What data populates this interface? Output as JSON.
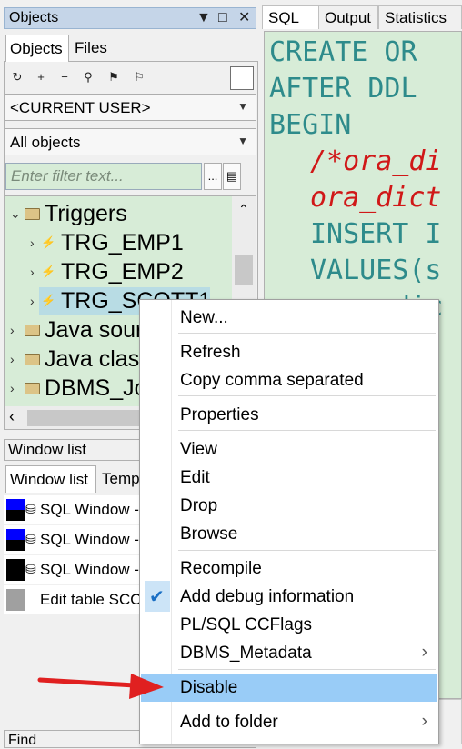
{
  "objects_panel": {
    "title": "Objects",
    "title_buttons": [
      "▼",
      "□",
      "✕"
    ],
    "tabs": [
      "Objects",
      "Files"
    ],
    "owner_combo": "<CURRENT USER>",
    "filter_combo": "All objects",
    "filter_placeholder": "Enter filter text...",
    "filter_btn_label": "...",
    "tree": [
      {
        "label": "Triggers",
        "kind": "folder",
        "expanded": true
      },
      {
        "label": "TRG_EMP1",
        "kind": "trigger"
      },
      {
        "label": "TRG_EMP2",
        "kind": "trigger"
      },
      {
        "label": "TRG_SCOTT1",
        "kind": "trigger",
        "selected": true
      },
      {
        "label": "Java sources",
        "kind": "folder"
      },
      {
        "label": "Java classes",
        "kind": "folder"
      },
      {
        "label": "DBMS_Jobs",
        "kind": "folder"
      }
    ]
  },
  "window_list": {
    "title": "Window list",
    "tabs": [
      "Window list",
      "Templates"
    ],
    "rows": [
      {
        "label": "SQL Window - ",
        "color": "#0000ff"
      },
      {
        "label": "SQL Window - ",
        "color": "#0000ff"
      },
      {
        "label": "SQL Window - ",
        "color": "#000000"
      },
      {
        "label": "Edit table SCOTT",
        "color": "#a0a0a0"
      }
    ]
  },
  "find_bar": {
    "label": "Find"
  },
  "editor": {
    "tabs": [
      "SQL",
      "Output",
      "Statistics"
    ],
    "lines": [
      {
        "text": "CREATE OR",
        "kind": "kw",
        "indent": 0
      },
      {
        "text": "AFTER DDL",
        "kind": "kw",
        "indent": 0
      },
      {
        "text": "BEGIN",
        "kind": "kw",
        "indent": 0
      },
      {
        "text": "/*ora_di",
        "kind": "cm",
        "indent": 2
      },
      {
        "text": "ora_dict",
        "kind": "cm",
        "indent": 2
      },
      {
        "text": "INSERT I",
        "kind": "kw",
        "indent": 2
      },
      {
        "text": "VALUES(s",
        "kind": "kw",
        "indent": 2
      },
      {
        "text": "dic",
        "kind": "kw",
        "indent": 8
      }
    ]
  },
  "context_menu": {
    "items": [
      {
        "label": "New...",
        "group": 1
      },
      {
        "label": "Refresh",
        "group": 2
      },
      {
        "label": "Copy comma separated",
        "group": 2
      },
      {
        "label": "Properties",
        "group": 3
      },
      {
        "label": "View",
        "group": 4
      },
      {
        "label": "Edit",
        "group": 4
      },
      {
        "label": "Drop",
        "group": 4
      },
      {
        "label": "Browse",
        "group": 4
      },
      {
        "label": "Recompile",
        "group": 5
      },
      {
        "label": "Add debug information",
        "group": 5,
        "checked": true
      },
      {
        "label": "PL/SQL CCFlags",
        "group": 5
      },
      {
        "label": "DBMS_Metadata",
        "group": 5,
        "submenu": true
      },
      {
        "label": "Disable",
        "group": 6,
        "highlighted": true
      },
      {
        "label": "Add to folder",
        "group": 7,
        "submenu": true
      }
    ],
    "submenu_glyph": "›",
    "check_glyph": "✔"
  },
  "colors": {
    "tree_bg": "#d7ecd7",
    "editor_bg": "#d7ecd7",
    "highlight": "#99ccf7",
    "keyword": "#2e8b8b",
    "comment": "#d01818",
    "arrow": "#e02020"
  }
}
